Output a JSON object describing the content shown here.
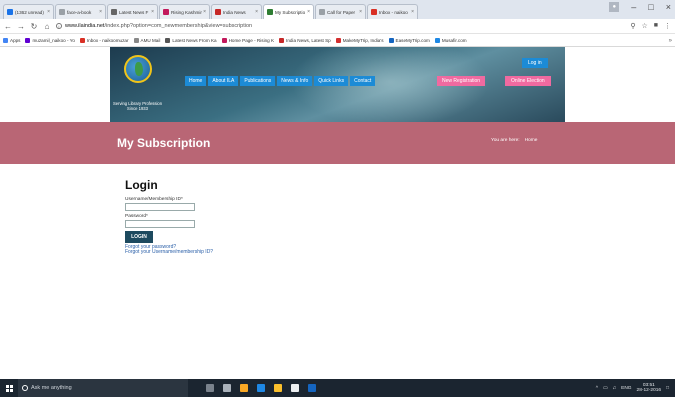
{
  "browser": {
    "tabs": [
      {
        "label": "(1362 unread)",
        "color": "#1a73e8"
      },
      {
        "label": "face-a-book",
        "color": "#9aa0a6"
      },
      {
        "label": "Latest News F",
        "color": "#666"
      },
      {
        "label": "Rising Kashmir",
        "color": "#c2185b"
      },
      {
        "label": "India News",
        "color": "#c62828"
      },
      {
        "label": "My Subscriptio",
        "color": "#2e7d32",
        "active": true
      },
      {
        "label": "Call for Paper",
        "color": "#9aa0a6"
      },
      {
        "label": "Inbox - naikoo",
        "color": "#d93025"
      }
    ],
    "url_domain": "www.ilaindia.net",
    "url_path": "/index.php?option=com_newmembership&view=subscription",
    "bookmarks": [
      {
        "label": "Apps",
        "color": "#4285f4"
      },
      {
        "label": "muzamil_naikoo - Yo",
        "color": "#6001d2"
      },
      {
        "label": "Inbox - naikoomuzar",
        "color": "#d93025"
      },
      {
        "label": "AMU Mail",
        "color": "#888"
      },
      {
        "label": "Latest News From Ka",
        "color": "#555"
      },
      {
        "label": "Home Page - Rising K",
        "color": "#c2185b"
      },
      {
        "label": "India News, Latest Sp",
        "color": "#c62828"
      },
      {
        "label": "MakeMyTrip, India's",
        "color": "#d32f2f"
      },
      {
        "label": "EaseMyTrip.com",
        "color": "#1565c0"
      },
      {
        "label": "Musafir.com",
        "color": "#1e88e5"
      }
    ]
  },
  "site": {
    "tagline_1": "Serving Library Profession",
    "tagline_2": "Since 1933",
    "menu": [
      "Home",
      "About ILA",
      "Publications",
      "News & Info",
      "Quick Links",
      "Contact"
    ],
    "new_registration": "New Registration",
    "online_election": "Online Election",
    "log_in": "Log in"
  },
  "page": {
    "title": "My Subscription",
    "breadcrumb_prefix": "You are here:",
    "breadcrumb_home": "Home"
  },
  "login": {
    "heading": "Login",
    "username_label": "Username/Membership ID*",
    "password_label": "Password*",
    "submit_label": "LOGIN",
    "forgot_password": "Forgot your password?",
    "forgot_username": "Forgot your Username/membership ID?"
  },
  "taskbar": {
    "search_placeholder": "Ask me anything",
    "apps": [
      "#7a828c",
      "#aab2bb",
      "#f9a825",
      "#1e88e5",
      "#fbc02d",
      "#eceff1",
      "#1565c0"
    ],
    "language": "ENG",
    "time": "03:51",
    "date": "28-12-2016"
  }
}
